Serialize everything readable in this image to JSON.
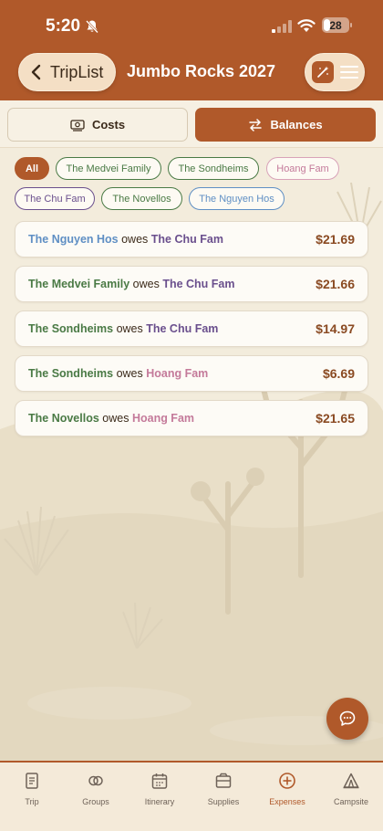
{
  "status": {
    "time": "5:20",
    "battery": "28"
  },
  "header": {
    "back_label": "TripList",
    "title": "Jumbo Rocks 2027"
  },
  "segments": {
    "costs": "Costs",
    "balances": "Balances",
    "selected": "Balances"
  },
  "filters": [
    {
      "label": "All",
      "selected": true
    },
    {
      "label": "The Medvei Family"
    },
    {
      "label": "The Sondheims"
    },
    {
      "label": "Hoang Fam"
    },
    {
      "label": "The Chu Fam"
    },
    {
      "label": "The Novellos"
    },
    {
      "label": "The Nguyen Hos"
    }
  ],
  "owes_word": "owes",
  "balances": [
    {
      "from": "The Nguyen Hos",
      "to": "The Chu Fam",
      "amount": "$21.69"
    },
    {
      "from": "The Medvei Family",
      "to": "The Chu Fam",
      "amount": "$21.66"
    },
    {
      "from": "The Sondheims",
      "to": "The Chu Fam",
      "amount": "$14.97"
    },
    {
      "from": "The Sondheims",
      "to": "Hoang Fam",
      "amount": "$6.69"
    },
    {
      "from": "The Novellos",
      "to": "Hoang Fam",
      "amount": "$21.65"
    }
  ],
  "tabs": [
    {
      "label": "Trip",
      "icon": "document-icon"
    },
    {
      "label": "Groups",
      "icon": "rings-icon"
    },
    {
      "label": "Itinerary",
      "icon": "calendar-icon"
    },
    {
      "label": "Supplies",
      "icon": "box-icon"
    },
    {
      "label": "Expenses",
      "icon": "plus-circle-icon",
      "active": true
    },
    {
      "label": "Campsite",
      "icon": "tent-icon"
    }
  ],
  "colors": {
    "brand": "#b0592a",
    "background": "#f3ecdc",
    "group_green": "#4a7a45",
    "group_blue": "#5f8fc4",
    "group_purple": "#6a4f8d",
    "group_pink": "#c47a9a"
  }
}
